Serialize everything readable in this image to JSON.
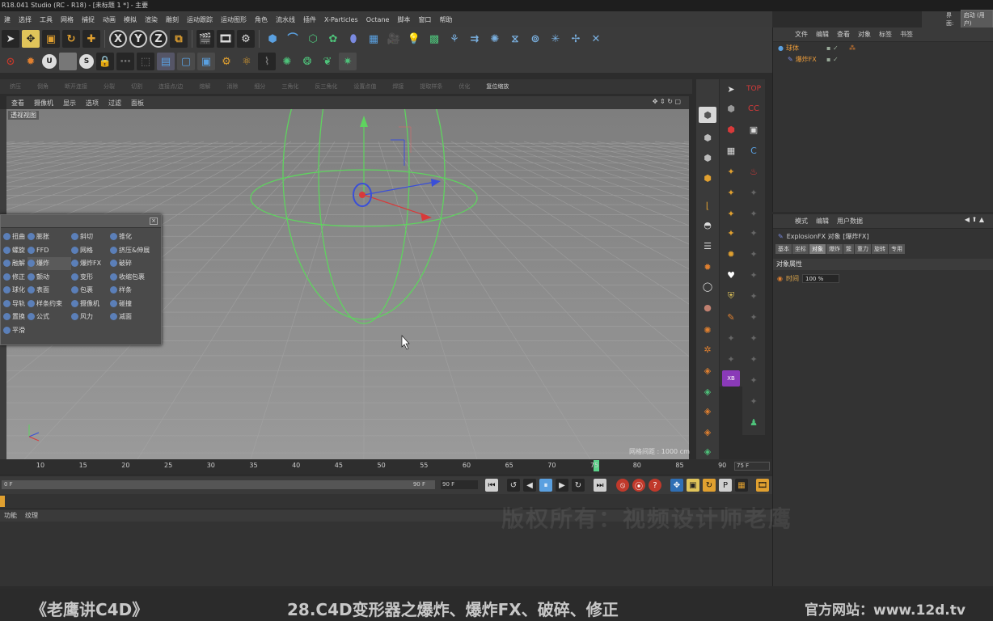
{
  "window": {
    "title": "R18.041 Studio (RC - R18) - [未标题 1 *] - 主要"
  },
  "menubar": {
    "items": [
      "建",
      "选择",
      "工具",
      "网格",
      "捕捉",
      "动画",
      "模拟",
      "渲染",
      "雕刻",
      "运动跟踪",
      "运动图形",
      "角色",
      "流水线",
      "插件",
      "X-Particles",
      "Octane",
      "脚本",
      "窗口",
      "帮助"
    ],
    "layout_label": "界面:",
    "layout_value": "启动 (用户)"
  },
  "toolbar_top": {
    "axis_x": "X",
    "axis_y": "Y",
    "axis_z": "Z"
  },
  "toolbar_secondary": {
    "items": [
      "挤压",
      "倒角",
      "断开连接",
      "分裂",
      "切割",
      "连接点/边",
      "熔解",
      "消除",
      "细分",
      "三角化",
      "反三角化",
      "设置点值",
      "焊接",
      "提取样条",
      "优化"
    ],
    "reset_label": "复位缩放"
  },
  "viewport": {
    "menu": [
      "查看",
      "摄像机",
      "显示",
      "选项",
      "过滤",
      "面板"
    ],
    "label": "透视视图",
    "grid_info": "网格间距 : 1000 cm"
  },
  "deformer_popup": {
    "items": [
      [
        "扭曲",
        "膨胀",
        "斜切",
        "锥化"
      ],
      [
        "螺旋",
        "FFD",
        "网格",
        "挤压&伸展"
      ],
      [
        "融解",
        "爆炸",
        "爆炸FX",
        "破碎"
      ],
      [
        "修正",
        "颤动",
        "变形",
        "收缩包裹"
      ],
      [
        "球化",
        "表面",
        "包裹",
        "样条"
      ],
      [
        "导轨",
        "样条约束",
        "摄像机",
        "碰撞"
      ],
      [
        "置换",
        "公式",
        "风力",
        "减面"
      ],
      [
        "平滑"
      ]
    ]
  },
  "object_manager": {
    "tabs": [
      "文件",
      "编辑",
      "查看",
      "对象",
      "标签",
      "书签"
    ],
    "objects": [
      {
        "name": "球体"
      },
      {
        "name": "爆炸FX"
      }
    ]
  },
  "attribute_manager": {
    "tabs": [
      "模式",
      "编辑",
      "用户数据"
    ],
    "title": "ExplosionFX 对象 [爆炸FX]",
    "subtabs": [
      "基本",
      "坐标",
      "对象",
      "爆炸",
      "簇",
      "重力",
      "旋转",
      "专用"
    ],
    "active_subtab": "对象",
    "section": "对象属性",
    "param_label": "时间",
    "param_value": "100 %"
  },
  "timeline": {
    "ticks": [
      "10",
      "15",
      "20",
      "25",
      "30",
      "35",
      "40",
      "45",
      "50",
      "55",
      "60",
      "65",
      "70",
      "75",
      "80",
      "85",
      "90"
    ],
    "current_frame": "75 F",
    "range_start": "0 F",
    "range_end": "90 F",
    "end_frame": "90 F"
  },
  "material_tabs": [
    "功能",
    "纹理"
  ],
  "overlay": {
    "watermark": "版权所有：视频设计师老鹰",
    "banner_left": "《老鹰讲C4D》",
    "banner_center": "28.C4D变形器之爆炸、爆炸FX、破碎、修正",
    "banner_right": "官方网站：www.12d.tv"
  },
  "colors": {
    "accent_yellow": "#e0c45a",
    "object_orange": "#e89a3a",
    "sphere_green": "#5fd35f",
    "playhead_green": "#5cd38a"
  }
}
